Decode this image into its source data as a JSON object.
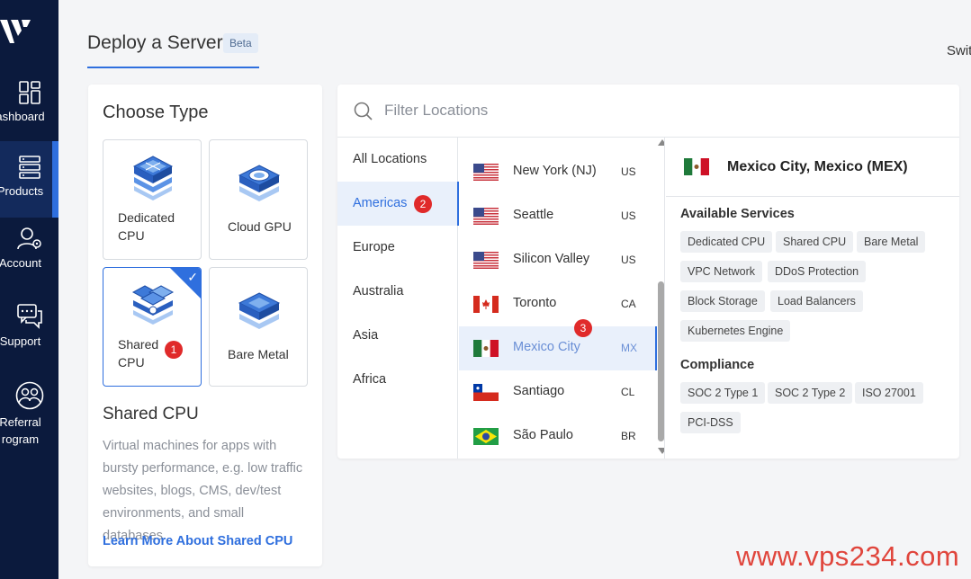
{
  "sidebar": {
    "items": [
      {
        "label": "ashboard",
        "icon": "dashboard-icon"
      },
      {
        "label": "Products",
        "icon": "server-stack-icon"
      },
      {
        "label": "Account",
        "icon": "user-gear-icon"
      },
      {
        "label": "Support",
        "icon": "chat-icon"
      },
      {
        "label": "Referral",
        "label2": "rogram",
        "icon": "referral-icon"
      }
    ]
  },
  "header": {
    "title": "Deploy a Server",
    "beta": "Beta",
    "switch_text": "Swit"
  },
  "choose_type": {
    "heading": "Choose Type",
    "tiles": [
      {
        "label": "Dedicated CPU",
        "icon": "dedicated-cpu-icon"
      },
      {
        "label": "Cloud GPU",
        "icon": "cloud-gpu-icon"
      },
      {
        "label": "Shared CPU",
        "icon": "shared-cpu-icon",
        "badge": "1",
        "selected": true
      },
      {
        "label": "Bare Metal",
        "icon": "bare-metal-icon"
      }
    ],
    "selected_title": "Shared CPU",
    "description": "Virtual machines for apps with bursty performance, e.g. low traffic websites, blogs, CMS, dev/test environments, and small databases.",
    "learn_more": "Learn More About Shared CPU"
  },
  "locations": {
    "filter_placeholder": "Filter Locations",
    "regions": [
      {
        "label": "All Locations"
      },
      {
        "label": "Americas",
        "badge": "2",
        "active": true
      },
      {
        "label": "Europe"
      },
      {
        "label": "Australia"
      },
      {
        "label": "Asia"
      },
      {
        "label": "Africa"
      }
    ],
    "cities": [
      {
        "name": "New York (NJ)",
        "code": "US",
        "flag": "us-flag-icon"
      },
      {
        "name": "Seattle",
        "code": "US",
        "flag": "us-flag-icon"
      },
      {
        "name": "Silicon Valley",
        "code": "US",
        "flag": "us-flag-icon"
      },
      {
        "name": "Toronto",
        "code": "CA",
        "flag": "ca-flag-icon"
      },
      {
        "name": "Mexico City",
        "code": "MX",
        "flag": "mx-flag-icon",
        "badge": "3",
        "selected": true
      },
      {
        "name": "Santiago",
        "code": "CL",
        "flag": "cl-flag-icon"
      },
      {
        "name": "São Paulo",
        "code": "BR",
        "flag": "br-flag-icon"
      }
    ],
    "detail": {
      "title": "Mexico City, Mexico (MEX)",
      "flag": "mx-flag-icon",
      "services_title": "Available Services",
      "services": [
        "Dedicated CPU",
        "Shared CPU",
        "Bare Metal",
        "VPC Network",
        "DDoS Protection",
        "Block Storage",
        "Load Balancers",
        "Kubernetes Engine"
      ],
      "compliance_title": "Compliance",
      "compliance": [
        "SOC 2 Type 1",
        "SOC 2 Type 2",
        "ISO 27001",
        "PCI-DSS"
      ]
    }
  },
  "watermark": "www.vps234.com",
  "colors": {
    "sidebar_bg": "#0b1a3d",
    "accent": "#2f6fde",
    "badge": "#e02a2a",
    "watermark": "#e0453c"
  }
}
